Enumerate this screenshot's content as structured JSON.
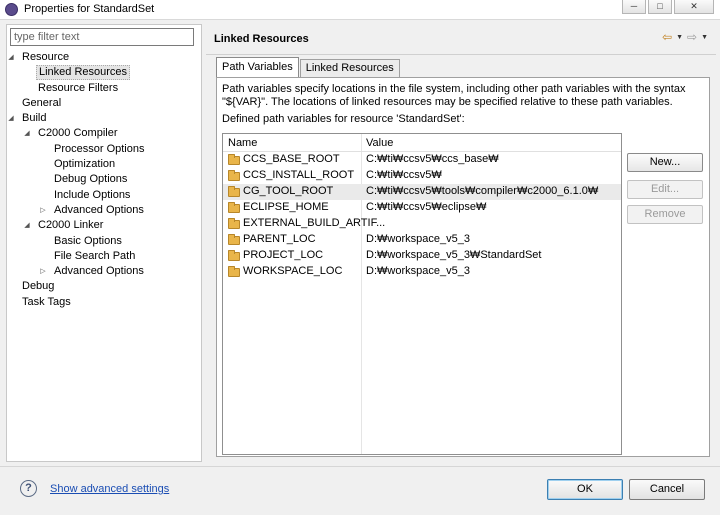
{
  "window": {
    "title": "Properties for StandardSet",
    "min": "─",
    "max": "□",
    "close": "✕"
  },
  "filter": {
    "placeholder": "type filter text"
  },
  "tree": [
    {
      "label": "Resource",
      "arrow": "◢",
      "level": 0
    },
    {
      "label": "Linked Resources",
      "arrow": "",
      "level": 1,
      "selected": true
    },
    {
      "label": "Resource Filters",
      "arrow": "",
      "level": 1
    },
    {
      "label": "General",
      "arrow": "",
      "level": 0
    },
    {
      "label": "Build",
      "arrow": "◢",
      "level": 0
    },
    {
      "label": "C2000 Compiler",
      "arrow": "◢",
      "level": 1
    },
    {
      "label": "Processor Options",
      "arrow": "",
      "level": 2
    },
    {
      "label": "Optimization",
      "arrow": "",
      "level": 2
    },
    {
      "label": "Debug Options",
      "arrow": "",
      "level": 2
    },
    {
      "label": "Include Options",
      "arrow": "",
      "level": 2
    },
    {
      "label": "Advanced Options",
      "arrow": "▷",
      "level": 2
    },
    {
      "label": "C2000 Linker",
      "arrow": "◢",
      "level": 1
    },
    {
      "label": "Basic Options",
      "arrow": "",
      "level": 2
    },
    {
      "label": "File Search Path",
      "arrow": "",
      "level": 2
    },
    {
      "label": "Advanced Options",
      "arrow": "▷",
      "level": 2
    },
    {
      "label": "Debug",
      "arrow": "",
      "level": 0
    },
    {
      "label": "Task Tags",
      "arrow": "",
      "level": 0
    }
  ],
  "page": {
    "title": "Linked Resources",
    "nav": {
      "back": "⇦",
      "forward": "⇨",
      "dropdown": "▼"
    },
    "tabs": [
      {
        "label": "Path Variables",
        "active": true
      },
      {
        "label": "Linked Resources",
        "active": false
      }
    ],
    "description": "Path variables specify locations in the file system, including other path variables with the syntax \"${VAR}\". The locations of linked resources may be specified relative to these path variables.",
    "defined_label": "Defined path variables for resource 'StandardSet':",
    "columns": {
      "name": "Name",
      "value": "Value"
    },
    "rows": [
      {
        "name": "CCS_BASE_ROOT",
        "value": "C:₩ti₩ccsv5₩ccs_base₩"
      },
      {
        "name": "CCS_INSTALL_ROOT",
        "value": "C:₩ti₩ccsv5₩"
      },
      {
        "name": "CG_TOOL_ROOT",
        "value": "C:₩ti₩ccsv5₩tools₩compiler₩c2000_6.1.0₩",
        "selected": true
      },
      {
        "name": "ECLIPSE_HOME",
        "value": "C:₩ti₩ccsv5₩eclipse₩"
      },
      {
        "name": "EXTERNAL_BUILD_ARTIF...",
        "value": ""
      },
      {
        "name": "PARENT_LOC",
        "value": "D:₩workspace_v5_3"
      },
      {
        "name": "PROJECT_LOC",
        "value": "D:₩workspace_v5_3₩StandardSet"
      },
      {
        "name": "WORKSPACE_LOC",
        "value": "D:₩workspace_v5_3"
      }
    ],
    "buttons": {
      "new": "New...",
      "edit": "Edit...",
      "remove": "Remove"
    }
  },
  "footer": {
    "help": "?",
    "advanced_link": "Show advanced settings",
    "ok": "OK",
    "cancel": "Cancel"
  }
}
